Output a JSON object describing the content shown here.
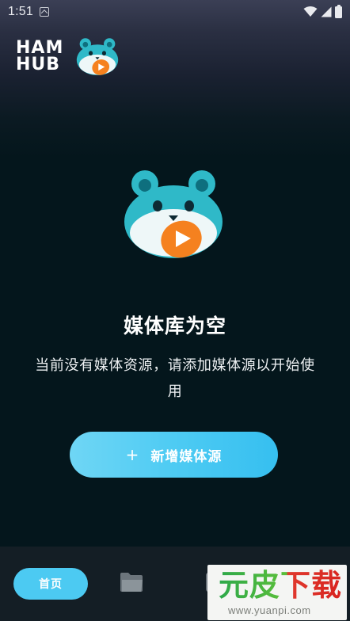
{
  "status_bar": {
    "time": "1:51",
    "icons": [
      "app-notification-icon",
      "wifi-icon",
      "signal-icon",
      "battery-icon"
    ]
  },
  "header": {
    "logo_line1": "HAM",
    "logo_line2": "HUB",
    "mascot_icon": "hamster-play-icon"
  },
  "empty_state": {
    "mascot_icon": "hamster-play-icon",
    "title": "媒体库为空",
    "description": "当前没有媒体资源，请添加媒体源以开始使用",
    "button_plus": "+",
    "button_label": "新增媒体源"
  },
  "bottom_nav": {
    "home_label": "首页",
    "folder_icon": "folder-icon",
    "third_icon": "document-icon"
  },
  "watermark": {
    "main": "元皮下载",
    "url": "www.yuanpi.com"
  },
  "colors": {
    "background": "#04161c",
    "accent": "#4ccaf2",
    "mascot_teal": "#2fb9c8",
    "play_orange": "#f5811f"
  }
}
